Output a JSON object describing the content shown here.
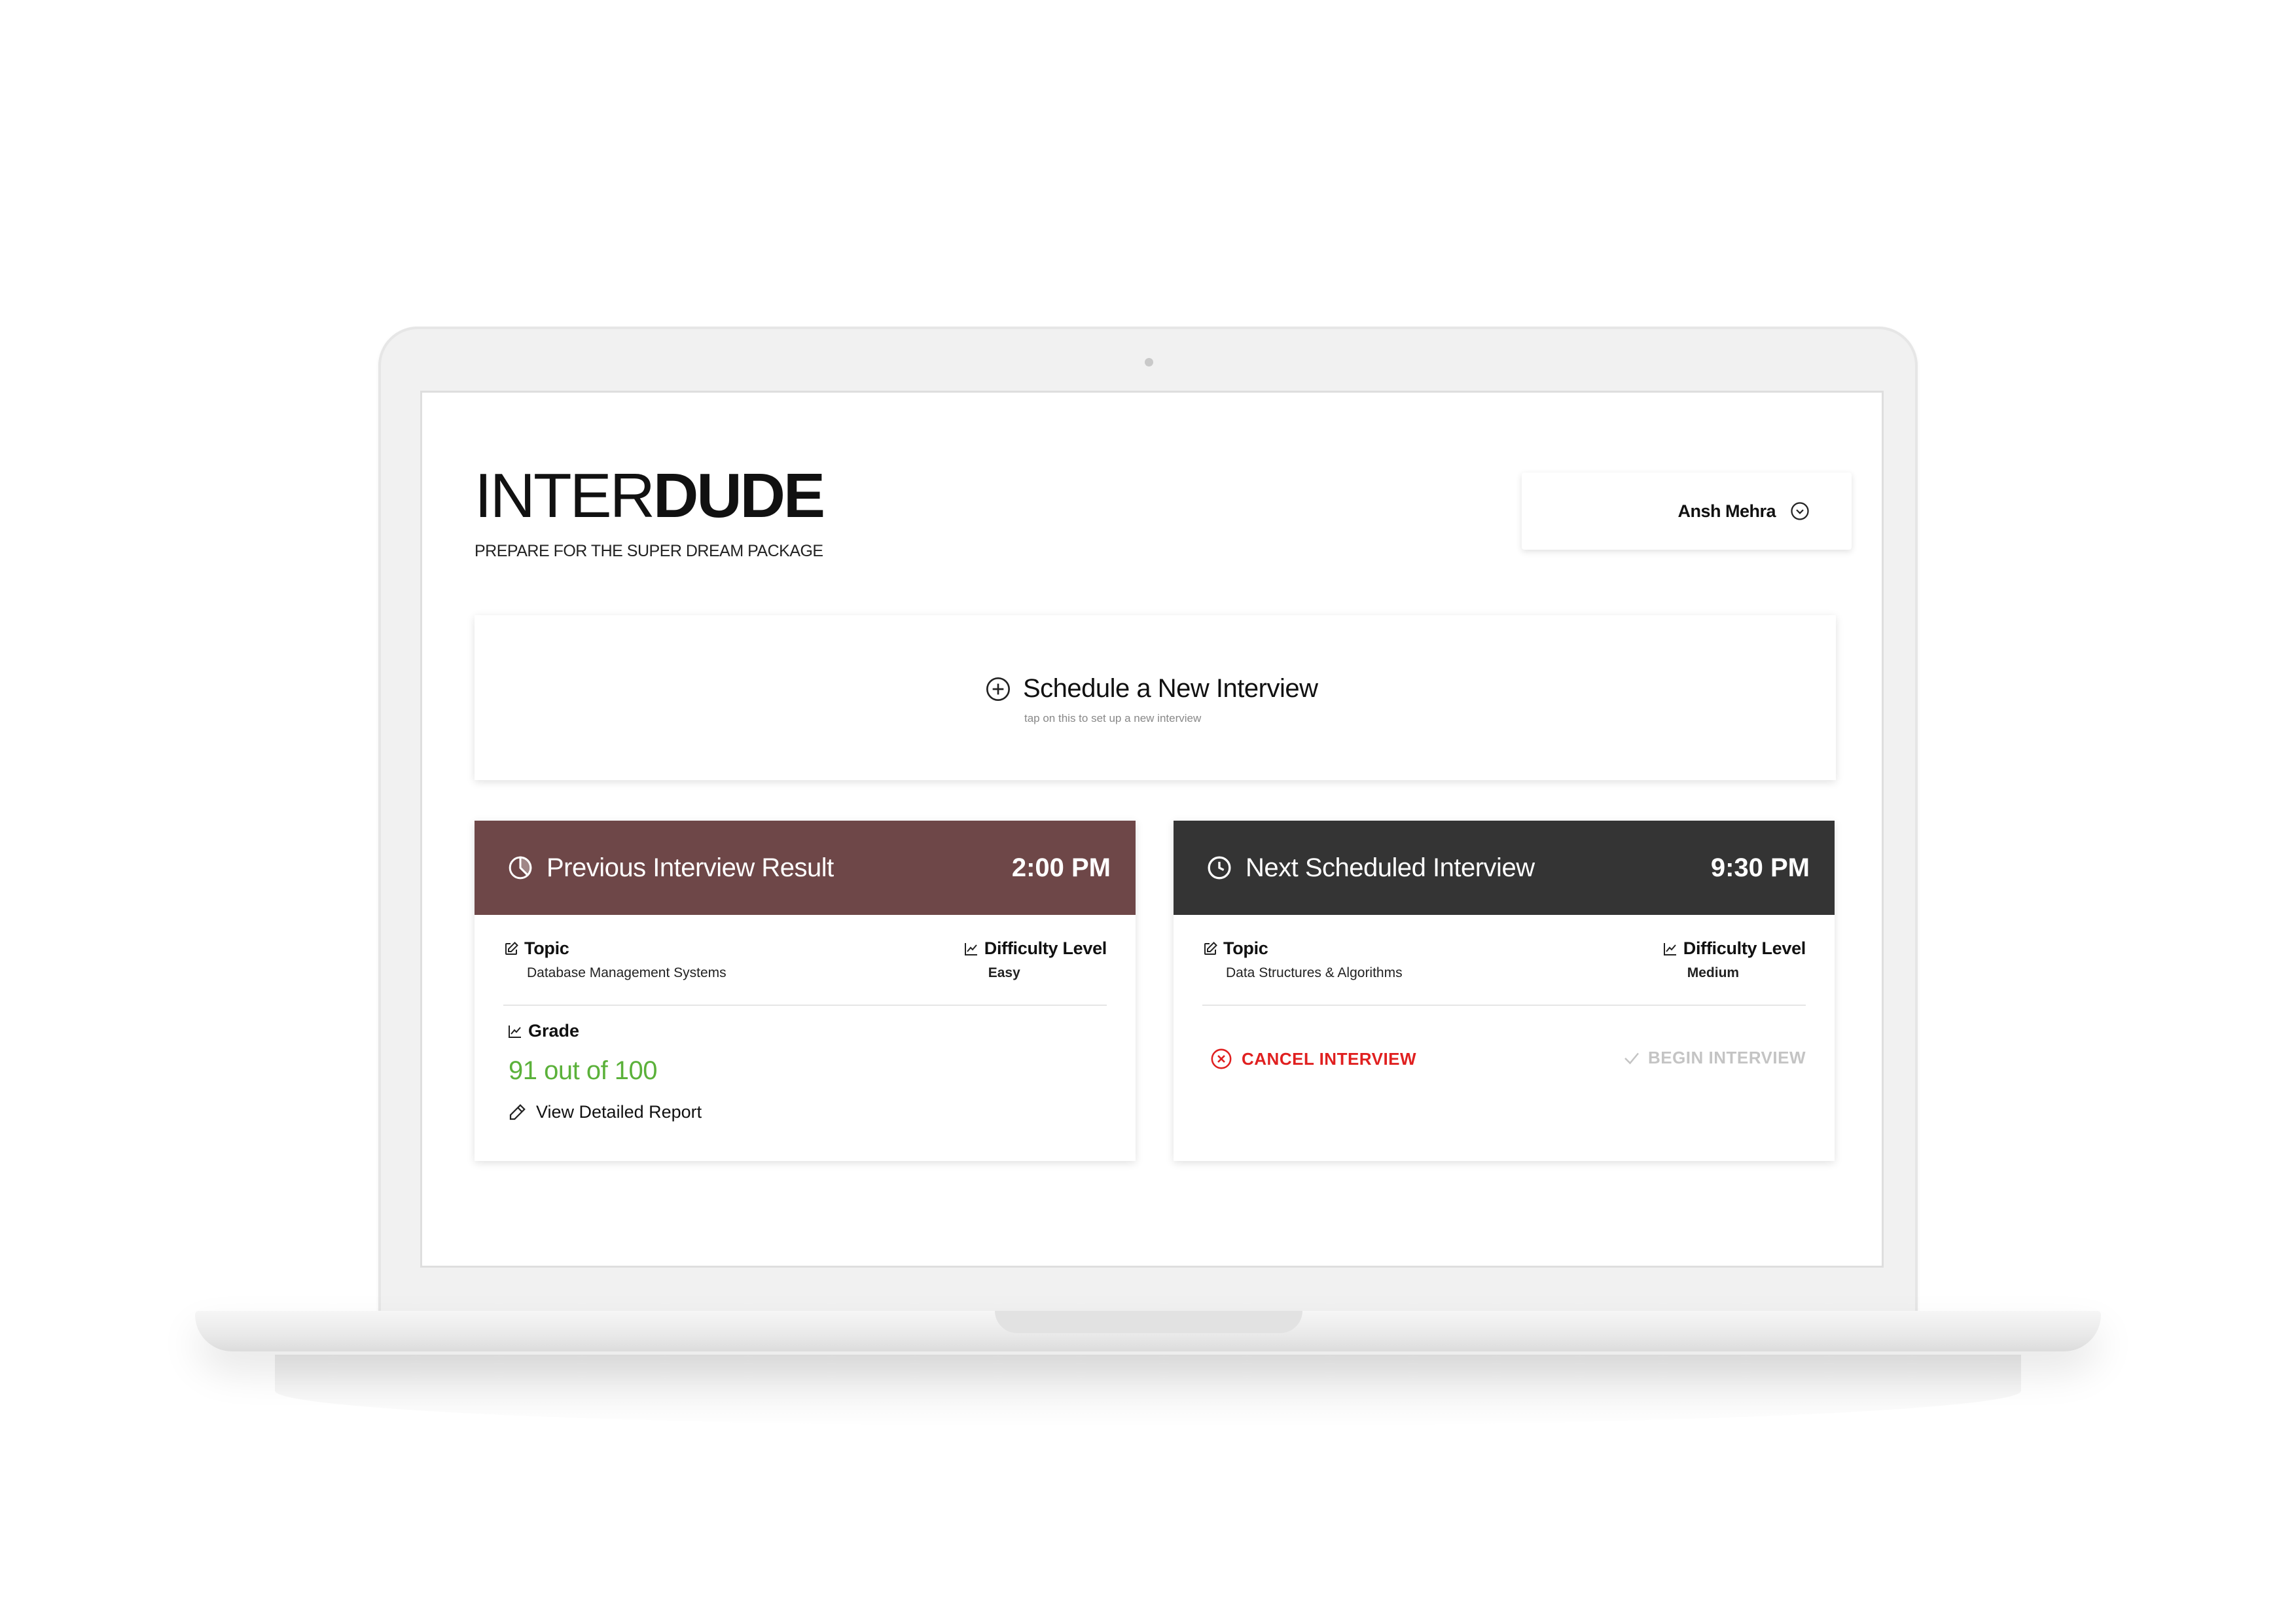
{
  "brand": {
    "name_light": "INTER",
    "name_bold": "DUDE",
    "tagline": "PREPARE FOR THE SUPER DREAM PACKAGE"
  },
  "user": {
    "name": "Ansh Mehra",
    "menu_icon": "chevron-down-circle-icon"
  },
  "schedule": {
    "title": "Schedule a New Interview",
    "subtitle": "tap on this to set up a new interview",
    "icon": "plus-circle-icon"
  },
  "previous": {
    "title_bold": "Previous",
    "title_rest": " Interview Result",
    "time": "2:00 PM",
    "icon": "pie-chart-icon",
    "topic_label": "Topic",
    "topic_value": "Database Management Systems",
    "difficulty_label": "Difficulty Level",
    "difficulty_value": "Easy",
    "grade_label": "Grade",
    "grade_value": "91 out of 100",
    "report_link": "View Detailed Report"
  },
  "next": {
    "title_bold": "Next",
    "title_rest": " Scheduled Interview",
    "time": "9:30 PM",
    "icon": "clock-icon",
    "topic_label": "Topic",
    "topic_value": "Data Structures & Algorithms",
    "difficulty_label": "Difficulty Level",
    "difficulty_value": "Medium",
    "cancel_label": "CANCEL INTERVIEW",
    "begin_label": "BEGIN INTERVIEW"
  },
  "colors": {
    "previous_header": "#6e4748",
    "next_header": "#343434",
    "grade": "#5bb13a",
    "cancel": "#e02020",
    "begin_disabled": "#c4c4c4"
  }
}
